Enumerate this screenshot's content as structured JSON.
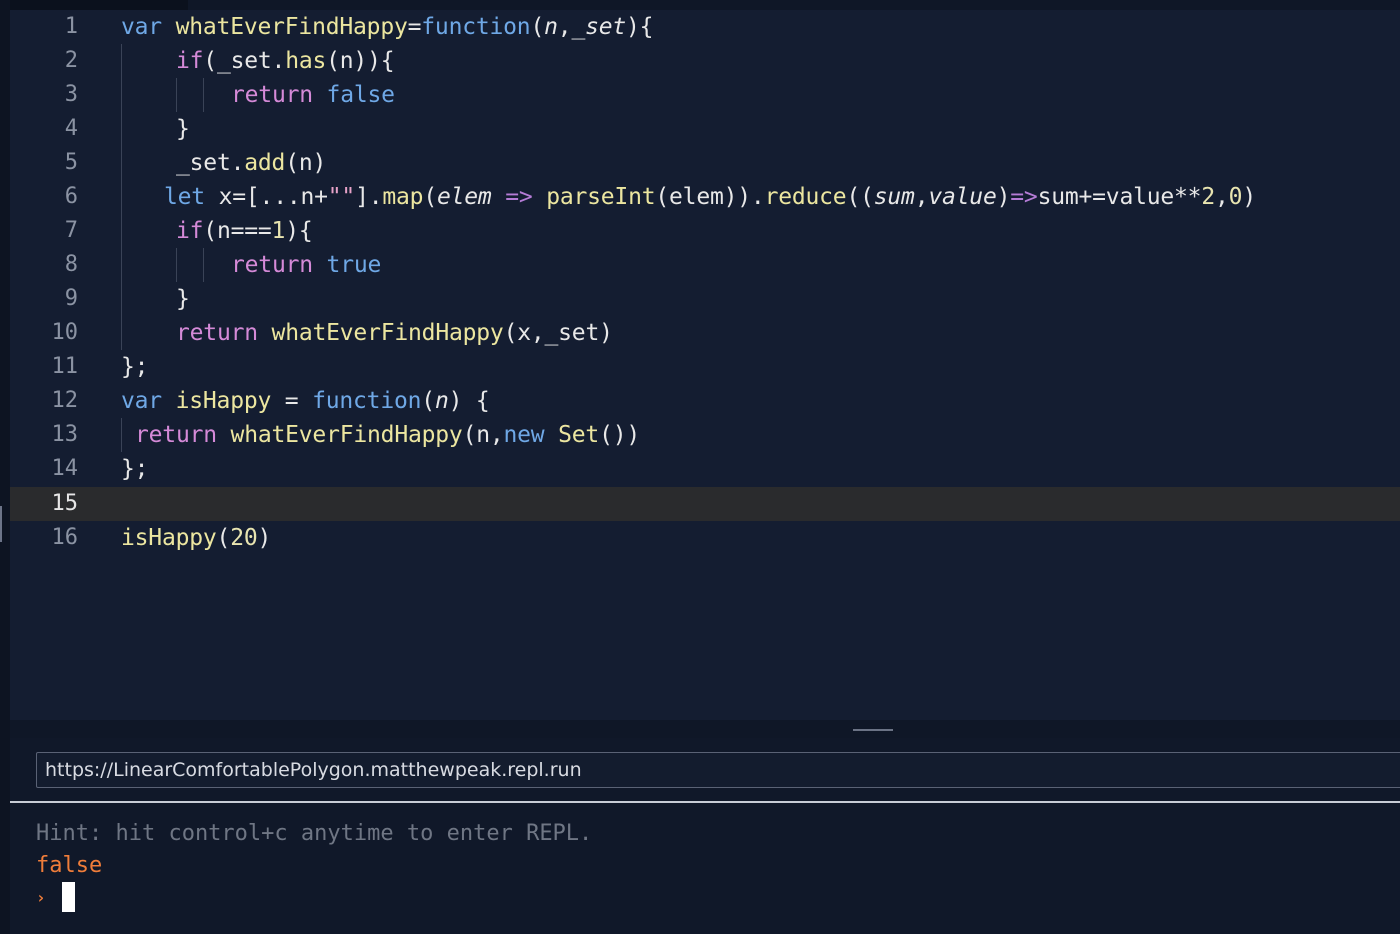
{
  "editor": {
    "active_line": 15,
    "lines": [
      {
        "n": "1"
      },
      {
        "n": "2"
      },
      {
        "n": "3"
      },
      {
        "n": "4"
      },
      {
        "n": "5"
      },
      {
        "n": "6"
      },
      {
        "n": "7"
      },
      {
        "n": "8"
      },
      {
        "n": "9"
      },
      {
        "n": "10"
      },
      {
        "n": "11"
      },
      {
        "n": "12"
      },
      {
        "n": "13"
      },
      {
        "n": "14"
      },
      {
        "n": "15"
      },
      {
        "n": "16"
      }
    ],
    "tokens": {
      "l1": [
        "var",
        " ",
        "whatEverFindHappy",
        "=",
        "function",
        "(",
        "n",
        ",",
        "_set",
        "){"
      ],
      "l2": [
        "if",
        "(_set.",
        "has",
        "(n)){"
      ],
      "l3": [
        "return",
        " ",
        "false"
      ],
      "l4": [
        "}"
      ],
      "l5": [
        "_set.",
        "add",
        "(n)"
      ],
      "l6": [
        "let",
        " x=[...n+",
        "\"\"",
        "].",
        "map",
        "(",
        "elem",
        " ",
        "=>",
        " ",
        "parseInt",
        "(elem)).",
        "reduce",
        "((",
        "sum",
        ",",
        "value",
        ")",
        "=>",
        "sum+=value**",
        "2",
        ",",
        "0",
        ")"
      ],
      "l7": [
        "if",
        "(n===",
        "1",
        "){"
      ],
      "l8": [
        "return",
        " ",
        "true"
      ],
      "l9": [
        "}"
      ],
      "l10": [
        "return",
        " ",
        "whatEverFindHappy",
        "(x,_set)"
      ],
      "l11": [
        "};"
      ],
      "l12": [
        "var",
        " ",
        "isHappy",
        " = ",
        "function",
        "(",
        "n",
        ") {"
      ],
      "l13": [
        "return",
        " ",
        "whatEverFindHappy",
        "(n,",
        "new",
        " ",
        "Set",
        "())"
      ],
      "l14": [
        "};"
      ],
      "l15": [
        ""
      ],
      "l16": [
        "isHappy",
        "(",
        "20",
        ")"
      ]
    }
  },
  "console": {
    "url": "https://LinearComfortablePolygon.matthewpeak.repl.run",
    "hint": "Hint: hit control+c anytime to enter REPL.",
    "output": "false",
    "prompt": "›"
  },
  "colors": {
    "editor_bg": "#141d31",
    "active_line_bg": "#2a2b2d",
    "keyword": "#6fa8e6",
    "control": "#d58ad8",
    "function": "#ece6a0",
    "output": "#f07d3a"
  }
}
